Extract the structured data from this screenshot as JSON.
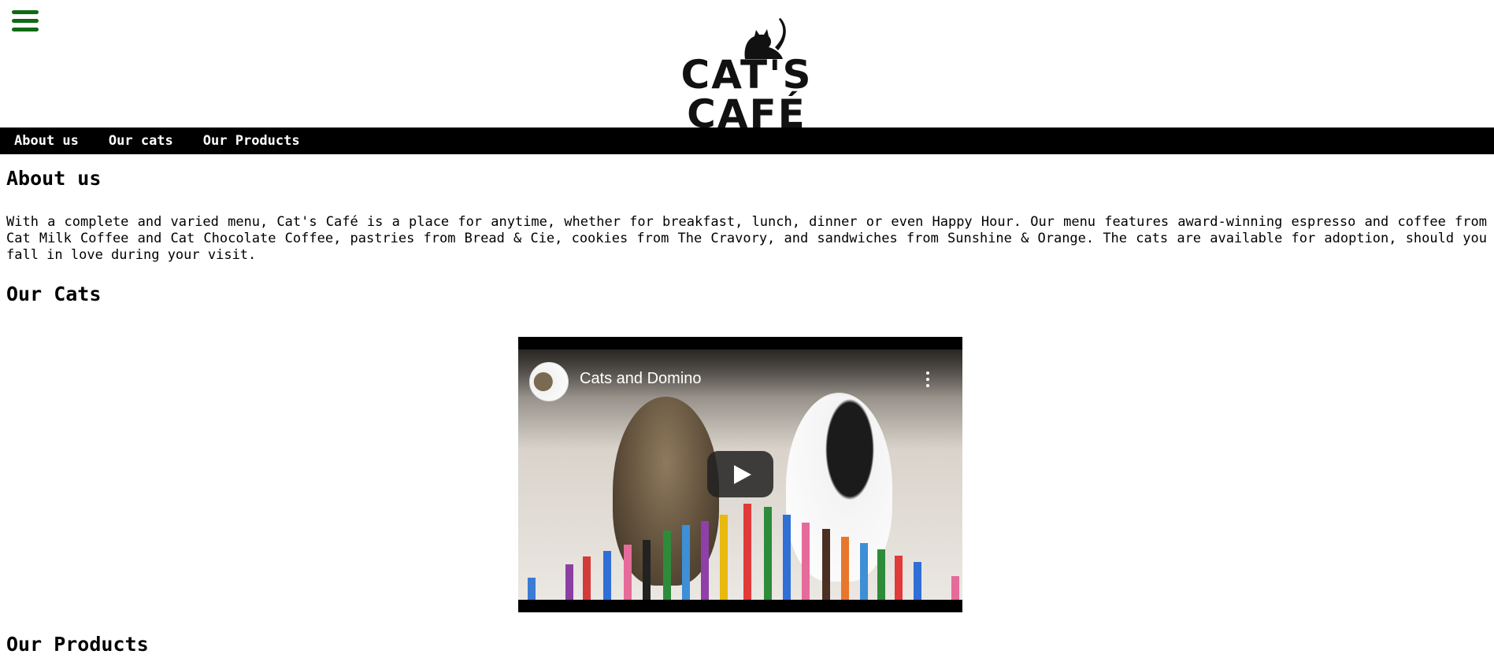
{
  "header": {
    "logo_text": "CAT'S CAFÉ"
  },
  "nav": {
    "items": [
      {
        "label": "About us"
      },
      {
        "label": "Our cats"
      },
      {
        "label": "Our Products"
      }
    ]
  },
  "about": {
    "heading": "About us",
    "text": "With a complete and varied menu, Cat's Café is a place for anytime, whether for breakfast, lunch, dinner or even Happy Hour. Our menu features award-winning espresso and coffee from Cat Milk Coffee and Cat Chocolate Coffee, pastries from Bread & Cie, cookies from The Cravory, and sandwiches from Sunshine & Orange. The cats are available for adoption, should you fall in love during your visit."
  },
  "cats": {
    "heading": "Our Cats",
    "video": {
      "title": "Cats and Domino",
      "icons": [
        "channel-avatar",
        "more-vert-icon",
        "play-icon"
      ]
    }
  },
  "products": {
    "heading": "Our Products"
  },
  "colors": {
    "menu_icon": "#0f6a13",
    "navbar_bg": "#000000",
    "nav_text": "#ffffff"
  }
}
